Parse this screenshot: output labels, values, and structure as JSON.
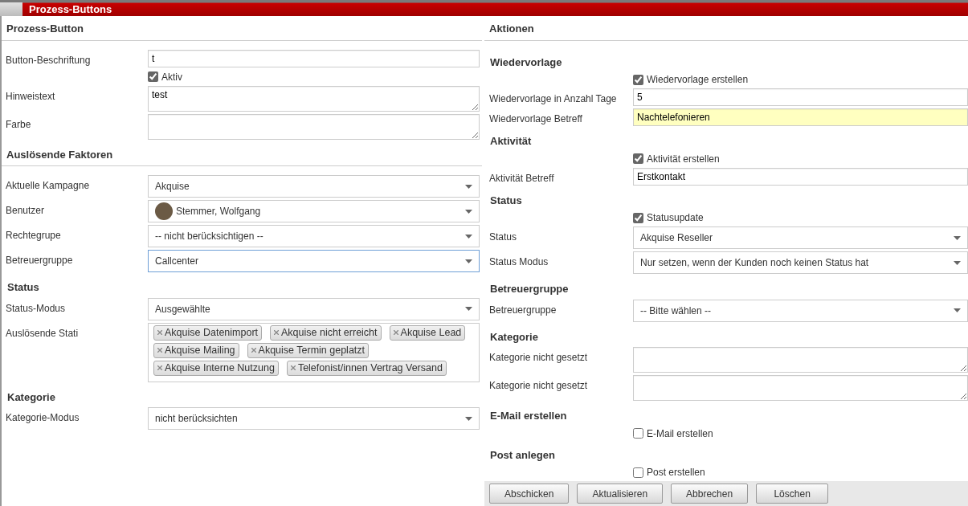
{
  "panel_title": "Prozess-Buttons",
  "left": [
    {
      "kind": "section",
      "text": "Prozess-Button"
    },
    {
      "kind": "input",
      "label": "Button-Beschriftung",
      "value": "t"
    },
    {
      "kind": "checkbox",
      "text": "Aktiv",
      "checked": true
    },
    {
      "kind": "textarea",
      "label": "Hinweistext",
      "value": "test"
    },
    {
      "kind": "textarea",
      "label": "Farbe"
    },
    {
      "kind": "section",
      "text": "Auslösende Faktoren"
    },
    {
      "kind": "select",
      "label": "Aktuelle Kampagne",
      "value": "Akquise"
    },
    {
      "kind": "select",
      "label": "Benutzer",
      "value": "Stemmer, Wolfgang",
      "avatar": true
    },
    {
      "kind": "select",
      "label": "Rechtegrupe",
      "value": "-- nicht berücksichtigen --"
    },
    {
      "kind": "select",
      "label": "Betreuergruppe",
      "value": "Callcenter",
      "focused": true
    },
    {
      "kind": "heading",
      "text": "Status"
    },
    {
      "kind": "select",
      "label": "Status-Modus",
      "value": "Ausgewählte"
    },
    {
      "kind": "tags",
      "label": "Auslösende Stati",
      "tags": [
        "Akquise Datenimport",
        "Akquise nicht erreicht",
        "Akquise Lead",
        "Akquise Mailing",
        "Akquise Termin geplatzt",
        "Akquise Interne Nutzung",
        "Telefonist/innen Vertrag Versand"
      ]
    },
    {
      "kind": "heading",
      "text": "Kategorie"
    },
    {
      "kind": "select",
      "label": "Kategorie-Modus",
      "value": "nicht berücksichten"
    }
  ],
  "right": [
    {
      "kind": "section",
      "text": "Aktionen"
    },
    {
      "kind": "heading",
      "text": "Wiedervorlage"
    },
    {
      "kind": "checkbox",
      "text": "Wiedervorlage erstellen",
      "checked": true
    },
    {
      "kind": "input",
      "label": "Wiedervorlage in Anzahl Tage",
      "value": "5"
    },
    {
      "kind": "input",
      "label": "Wiedervorlage Betreff",
      "value": "Nachtelefonieren",
      "highlighted": true
    },
    {
      "kind": "heading",
      "text": "Aktivität"
    },
    {
      "kind": "checkbox",
      "text": "Aktivität erstellen",
      "checked": true
    },
    {
      "kind": "input",
      "label": "Aktivität Betreff",
      "value": "Erstkontakt"
    },
    {
      "kind": "heading",
      "text": "Status"
    },
    {
      "kind": "checkbox",
      "text": "Statusupdate",
      "checked": true
    },
    {
      "kind": "select",
      "label": "Status",
      "value": "Akquise Reseller"
    },
    {
      "kind": "select",
      "label": "Status Modus",
      "value": "Nur setzen, wenn der Kunden noch keinen Status hat"
    },
    {
      "kind": "heading",
      "text": "Betreuergruppe"
    },
    {
      "kind": "select",
      "label": "Betreuergruppe",
      "value": "-- Bitte wählen --"
    },
    {
      "kind": "heading",
      "text": "Kategorie"
    },
    {
      "kind": "textarea",
      "label": "Kategorie nicht gesetzt"
    },
    {
      "kind": "textarea",
      "label": "Kategorie nicht gesetzt"
    },
    {
      "kind": "heading",
      "text": "E-Mail erstellen"
    },
    {
      "kind": "checkbox",
      "text": "E-Mail erstellen",
      "checked": false
    },
    {
      "kind": "heading",
      "text": "Post anlegen"
    },
    {
      "kind": "checkbox",
      "text": "Post erstellen",
      "checked": false
    }
  ],
  "buttons": [
    "Abschicken",
    "Aktualisieren",
    "Abbrechen",
    "Löschen"
  ]
}
